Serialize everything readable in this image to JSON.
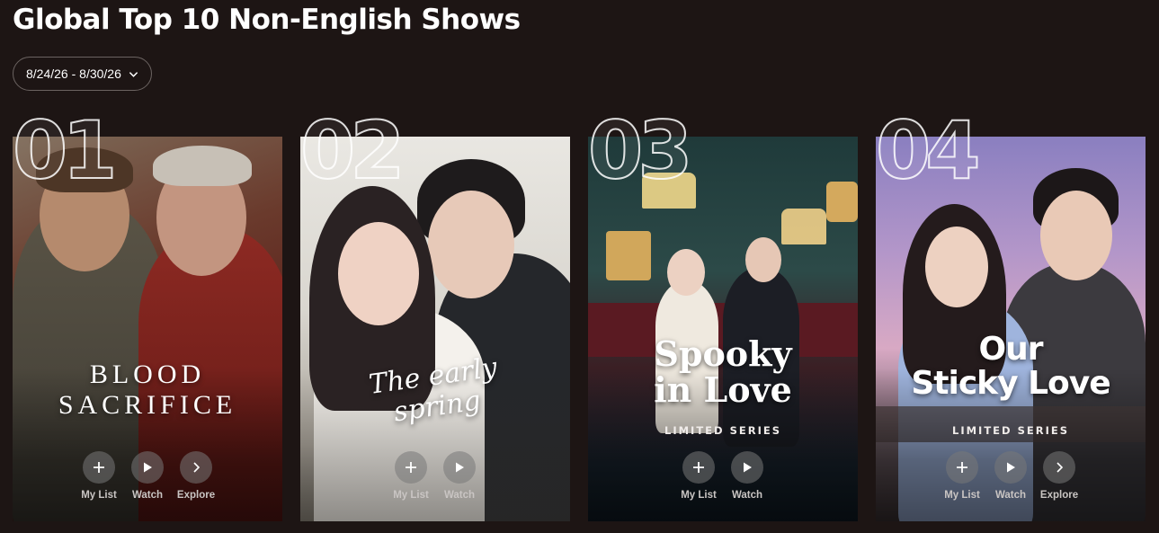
{
  "page": {
    "title": "Global Top 10 Non-English Shows"
  },
  "week_selector": {
    "value": "8/24/26 - 8/30/26"
  },
  "actions": {
    "my_list": "My List",
    "watch": "Watch",
    "explore": "Explore"
  },
  "shows": [
    {
      "rank": "01",
      "title": "BLOOD\nSACRIFICE",
      "tag": ""
    },
    {
      "rank": "02",
      "title": "The early\nspring",
      "tag": ""
    },
    {
      "rank": "03",
      "title": "Spooky\nin Love",
      "tag": "LIMITED SERIES"
    },
    {
      "rank": "04",
      "title": "Our\nSticky Love",
      "tag": "LIMITED SERIES"
    }
  ],
  "icons": [
    "plus-icon",
    "play-icon",
    "chevron-right-icon",
    "chevron-down-icon"
  ]
}
